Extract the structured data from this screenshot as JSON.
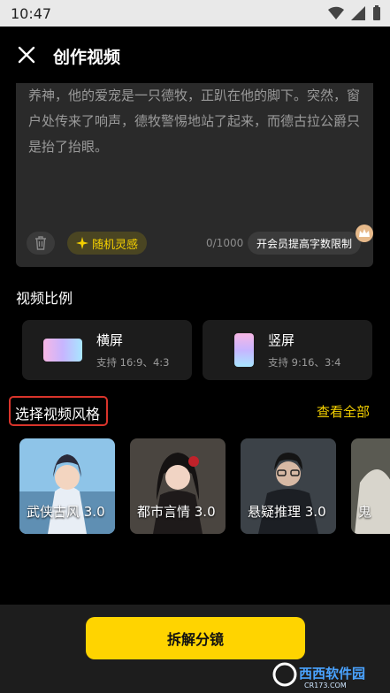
{
  "status_bar": {
    "time": "10:47"
  },
  "header": {
    "title": "创作视频"
  },
  "story": {
    "text": "养神，他的爱宠是一只德牧，正趴在他的脚下。突然，窗户处传来了响声，德牧警惕地站了起来，而德古拉公爵只是抬了抬眼。",
    "random_label": "随机灵感",
    "counter": "0/1000",
    "vip_label": "开会员提高字数限制"
  },
  "ratio": {
    "title": "视频比例",
    "options": [
      {
        "name": "横屏",
        "desc": "支持 16:9、4:3"
      },
      {
        "name": "竖屏",
        "desc": "支持 9:16、3:4"
      }
    ]
  },
  "styles": {
    "title": "选择视频风格",
    "view_all": "查看全部",
    "items": [
      {
        "label": "武侠古风 3.0"
      },
      {
        "label": "都市言情 3.0"
      },
      {
        "label": "悬疑推理 3.0"
      },
      {
        "label": "鬼"
      }
    ]
  },
  "action": {
    "label": "拆解分镜"
  },
  "watermark": {
    "text": "西西软件园",
    "sub": "CR173.COM"
  },
  "colors": {
    "accent": "#ffd400",
    "highlight_box": "#d9342b",
    "background": "#000000",
    "card": "#2a2a2a"
  }
}
